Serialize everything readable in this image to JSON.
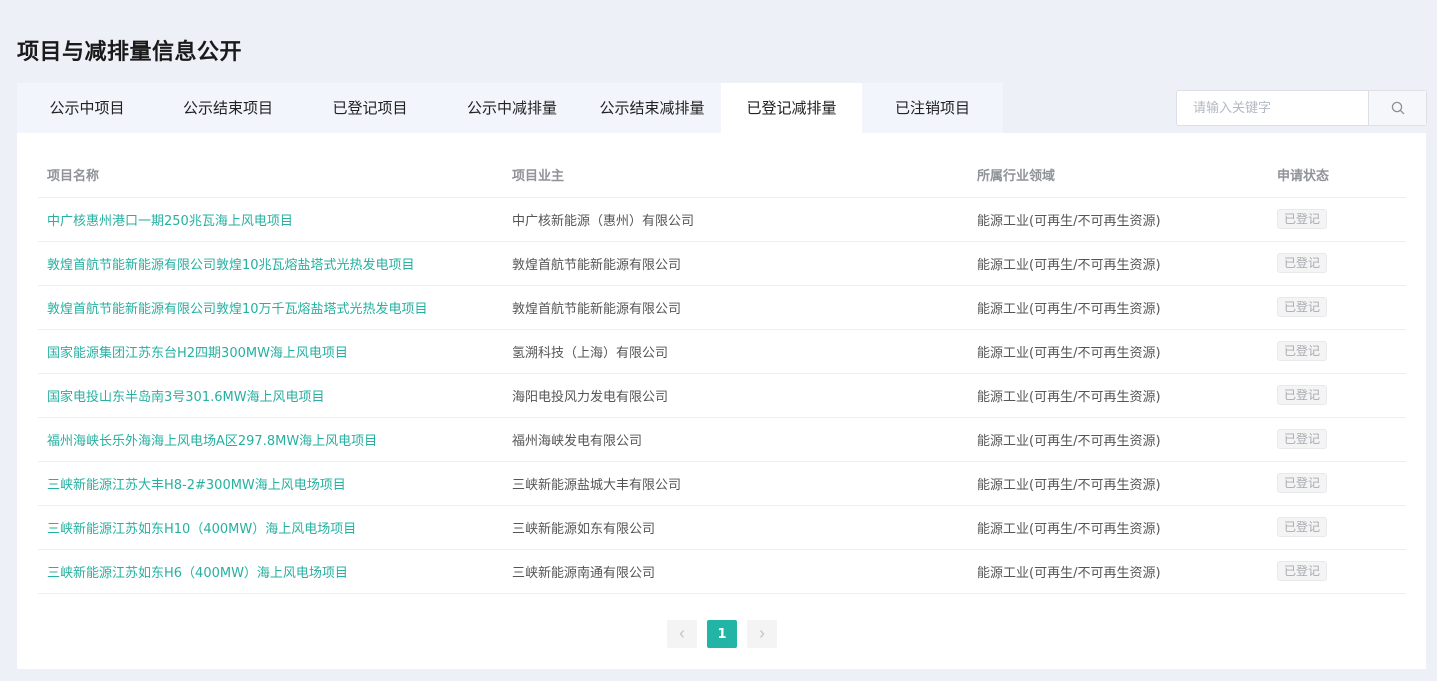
{
  "page": {
    "title": "项目与减排量信息公开"
  },
  "tabs": [
    {
      "label": "公示中项目"
    },
    {
      "label": "公示结束项目"
    },
    {
      "label": "已登记项目"
    },
    {
      "label": "公示中减排量"
    },
    {
      "label": "公示结束减排量"
    },
    {
      "label": "已登记减排量",
      "active": true
    },
    {
      "label": "已注销项目"
    }
  ],
  "search": {
    "placeholder": "请输入关键字",
    "value": "",
    "icon": "search-icon"
  },
  "table": {
    "headers": {
      "name": "项目名称",
      "owner": "项目业主",
      "industry": "所属行业领域",
      "status": "申请状态"
    },
    "rows": [
      {
        "name": "中广核惠州港口一期250兆瓦海上风电项目",
        "owner": "中广核新能源（惠州）有限公司",
        "industry": "能源工业(可再生/不可再生资源)",
        "status": "已登记"
      },
      {
        "name": "敦煌首航节能新能源有限公司敦煌10兆瓦熔盐塔式光热发电项目",
        "owner": "敦煌首航节能新能源有限公司",
        "industry": "能源工业(可再生/不可再生资源)",
        "status": "已登记"
      },
      {
        "name": "敦煌首航节能新能源有限公司敦煌10万千瓦熔盐塔式光热发电项目",
        "owner": "敦煌首航节能新能源有限公司",
        "industry": "能源工业(可再生/不可再生资源)",
        "status": "已登记"
      },
      {
        "name": "国家能源集团江苏东台H2四期300MW海上风电项目",
        "owner": "氢溯科技（上海）有限公司",
        "industry": "能源工业(可再生/不可再生资源)",
        "status": "已登记"
      },
      {
        "name": "国家电投山东半岛南3号301.6MW海上风电项目",
        "owner": "海阳电投风力发电有限公司",
        "industry": "能源工业(可再生/不可再生资源)",
        "status": "已登记"
      },
      {
        "name": "福州海峡长乐外海海上风电场A区297.8MW海上风电项目",
        "owner": "福州海峡发电有限公司",
        "industry": "能源工业(可再生/不可再生资源)",
        "status": "已登记"
      },
      {
        "name": "三峡新能源江苏大丰H8-2#300MW海上风电场项目",
        "owner": "三峡新能源盐城大丰有限公司",
        "industry": "能源工业(可再生/不可再生资源)",
        "status": "已登记"
      },
      {
        "name": "三峡新能源江苏如东H10（400MW）海上风电场项目",
        "owner": "三峡新能源如东有限公司",
        "industry": "能源工业(可再生/不可再生资源)",
        "status": "已登记"
      },
      {
        "name": "三峡新能源江苏如东H6（400MW）海上风电场项目",
        "owner": "三峡新能源南通有限公司",
        "industry": "能源工业(可再生/不可再生资源)",
        "status": "已登记"
      }
    ]
  },
  "pagination": {
    "prev_icon": "chevron-left-icon",
    "current_page": "1",
    "next_icon": "chevron-right-icon"
  },
  "colors": {
    "accent": "#22b5a6",
    "link": "#26b0a0",
    "background": "#eef0f8"
  }
}
